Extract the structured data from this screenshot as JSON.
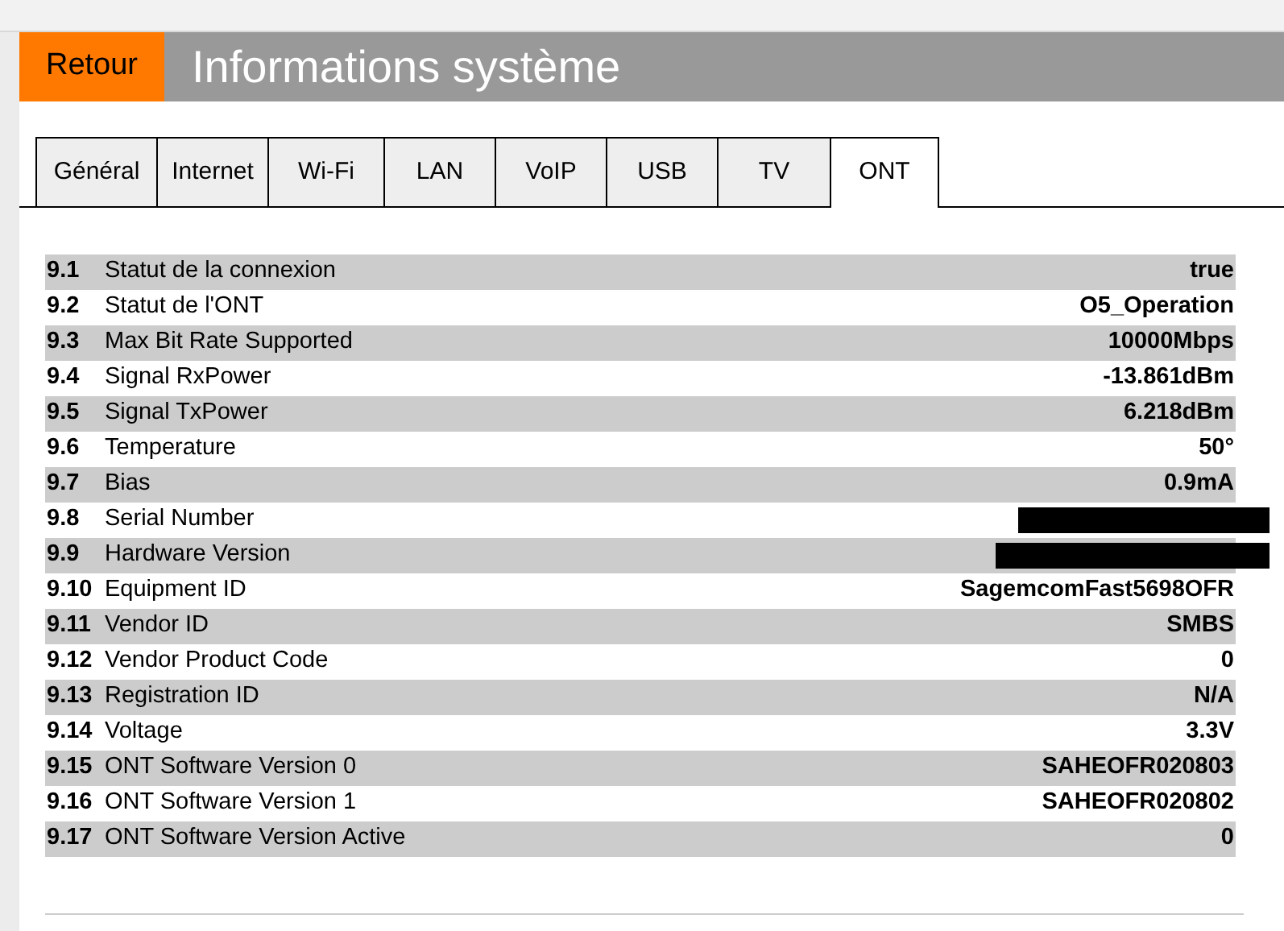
{
  "header": {
    "back_button": "Retour",
    "title": "Informations système"
  },
  "tabs": [
    {
      "label": "Général",
      "selected": false
    },
    {
      "label": "Internet",
      "selected": false
    },
    {
      "label": "Wi-Fi",
      "selected": false
    },
    {
      "label": "LAN",
      "selected": false
    },
    {
      "label": "VoIP",
      "selected": false
    },
    {
      "label": "USB",
      "selected": false
    },
    {
      "label": "TV",
      "selected": false
    },
    {
      "label": "ONT",
      "selected": true
    }
  ],
  "table": {
    "rows": [
      {
        "index": "9.1",
        "label": "Statut de la connexion",
        "kind": "value",
        "value": "true"
      },
      {
        "index": "9.2",
        "label": "Statut de l'ONT",
        "kind": "value",
        "value": "O5_Operation"
      },
      {
        "index": "9.3",
        "label": "Max Bit Rate Supported",
        "kind": "value",
        "value": "10000Mbps"
      },
      {
        "index": "9.4",
        "label": "Signal RxPower",
        "kind": "value",
        "value": "-13.861dBm"
      },
      {
        "index": "9.5",
        "label": "Signal TxPower",
        "kind": "value",
        "value": "6.218dBm"
      },
      {
        "index": "9.6",
        "label": "Temperature",
        "kind": "value",
        "value": "50°"
      },
      {
        "index": "9.7",
        "label": "Bias",
        "kind": "value",
        "value": "0.9mA"
      },
      {
        "index": "9.8",
        "label": "Serial Number",
        "kind": "redacted"
      },
      {
        "index": "9.9",
        "label": "Hardware Version",
        "kind": "redacted"
      },
      {
        "index": "9.10",
        "label": "Equipment ID",
        "kind": "value",
        "value": "SagemcomFast5698OFR"
      },
      {
        "index": "9.11",
        "label": "Vendor ID",
        "kind": "value",
        "value": "SMBS"
      },
      {
        "index": "9.12",
        "label": "Vendor Product Code",
        "kind": "value",
        "value": "0"
      },
      {
        "index": "9.13",
        "label": "Registration ID",
        "kind": "value",
        "value": "N/A"
      },
      {
        "index": "9.14",
        "label": "Voltage",
        "kind": "value",
        "value": "3.3V"
      },
      {
        "index": "9.15",
        "label": "ONT Software Version 0",
        "kind": "value",
        "value": "SAHEOFR020803"
      },
      {
        "index": "9.16",
        "label": "ONT Software Version 1",
        "kind": "value",
        "value": "SAHEOFR020802"
      },
      {
        "index": "9.17",
        "label": "ONT Software Version Active",
        "kind": "value",
        "value": "0"
      }
    ]
  }
}
